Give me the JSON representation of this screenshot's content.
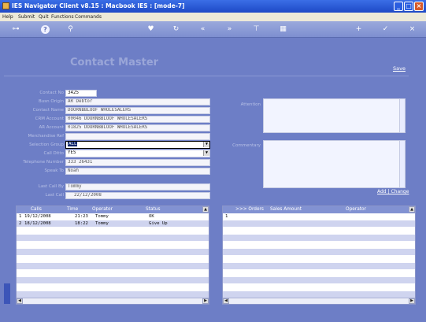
{
  "window": {
    "title": "IES Navigator Client v8.15 : Macbook IES :       [mode-7]"
  },
  "menu": [
    "Help",
    "Submit",
    "Quit",
    "Functions",
    "Commands"
  ],
  "toolbar": {
    "icons": [
      "key-icon",
      "help-icon",
      "search-icon",
      "heart-icon",
      "refresh-icon",
      "rewind-icon",
      "fast-forward-icon",
      "filter-icon",
      "grid-icon",
      "add-icon",
      "check-icon",
      "close-icon"
    ],
    "help_glyph": "?"
  },
  "page": {
    "title": "Contact Master",
    "save_label": "Save",
    "add_change_label": "Add | Change"
  },
  "form": {
    "contact_no_label": "Contact No",
    "contact_no": "3425",
    "bus_origin_label": "Busn Origin",
    "bus_origin": "AR Debtor",
    "contact_name_label": "Contact Name",
    "contact_name": "DOORNBBLOOF WHOLESALERS",
    "crm_account_label": "CRM Account",
    "crm_account": "00046 DOORNBBLOOF WHOLESALERS",
    "ar_account_label": "AR Account",
    "ar_account": "01825 DOORNBBLOOF WHOLESALERS",
    "merchandise_ref_label": "Merchandise Ref",
    "merchandise_ref": "",
    "selection_group_label": "Selection Group",
    "selection_group": "ALL",
    "call_ditto_label": "Call Ditto",
    "call_ditto": "YES",
    "telephone_label": "Telephone Number",
    "telephone": "333 26431",
    "speak_to_label": "Speak To",
    "speak_to": "Noah",
    "last_call_by_label": "Last Call By",
    "last_call_by": "Tommy",
    "last_call_label": "Last Call",
    "last_call": "22/12/2008",
    "attention_label": "Attention",
    "attention": "",
    "commentary_label": "Commentary",
    "commentary": ""
  },
  "calls_grid": {
    "headers": [
      "Calls",
      "Time",
      "Operator",
      "Status"
    ],
    "rows": [
      {
        "num": "1",
        "date": "19/12/2008",
        "time": "21:23",
        "operator": "Tommy",
        "status": "OK"
      },
      {
        "num": "2",
        "date": "18/12/2008",
        "time": "18:22",
        "operator": "Tommy",
        "status": "Give Up"
      }
    ]
  },
  "orders_grid": {
    "headers": [
      ">>> Orders",
      "Sales Amount",
      "Operator"
    ],
    "rows": [
      {
        "num": "1",
        "order": "",
        "amount": "",
        "operator": ""
      }
    ]
  },
  "colors": {
    "background": "#6d7ec6",
    "titlebar": "#1d49c6",
    "grid_header": "#8292d2",
    "row_alt": "#cfd4ef"
  }
}
